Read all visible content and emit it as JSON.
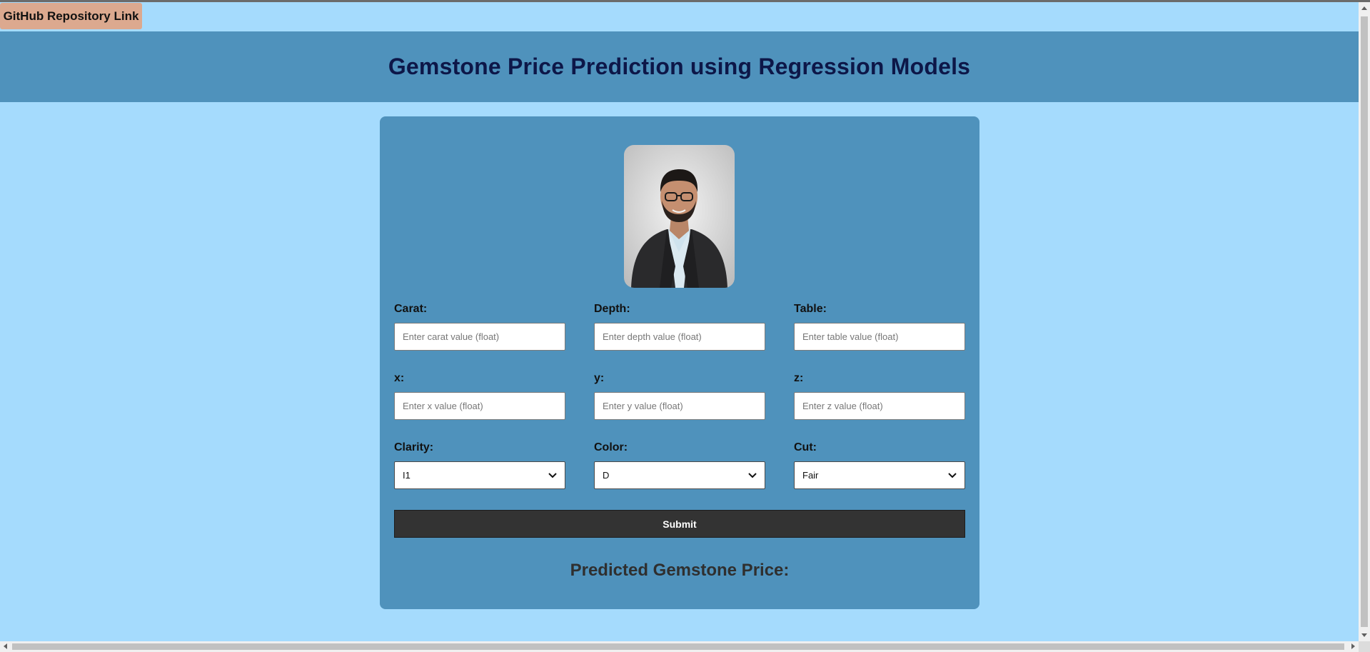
{
  "nav": {
    "github_link_label": "GitHub Repository Link"
  },
  "header": {
    "title": "Gemstone Price Prediction using Regression Models"
  },
  "form": {
    "carat": {
      "label": "Carat:",
      "placeholder": "Enter carat value (float)",
      "value": ""
    },
    "depth": {
      "label": "Depth:",
      "placeholder": "Enter depth value (float)",
      "value": ""
    },
    "table": {
      "label": "Table:",
      "placeholder": "Enter table value (float)",
      "value": ""
    },
    "x": {
      "label": "x:",
      "placeholder": "Enter x value (float)",
      "value": ""
    },
    "y": {
      "label": "y:",
      "placeholder": "Enter y value (float)",
      "value": ""
    },
    "z": {
      "label": "z:",
      "placeholder": "Enter z value (float)",
      "value": ""
    },
    "clarity": {
      "label": "Clarity:",
      "selected": "I1"
    },
    "color": {
      "label": "Color:",
      "selected": "D"
    },
    "cut": {
      "label": "Cut:",
      "selected": "Fair"
    },
    "submit_label": "Submit"
  },
  "result": {
    "label": "Predicted Gemstone Price:"
  },
  "colors": {
    "page_background": "#a5dbfd",
    "header_background": "#4f92bc",
    "card_background": "#4f92bc",
    "github_button": "#dca98f",
    "title_text": "#0d1748",
    "submit_button": "#333333"
  },
  "icons": {
    "select_arrow": "chevron-down-icon",
    "photo": "profile-photo"
  }
}
